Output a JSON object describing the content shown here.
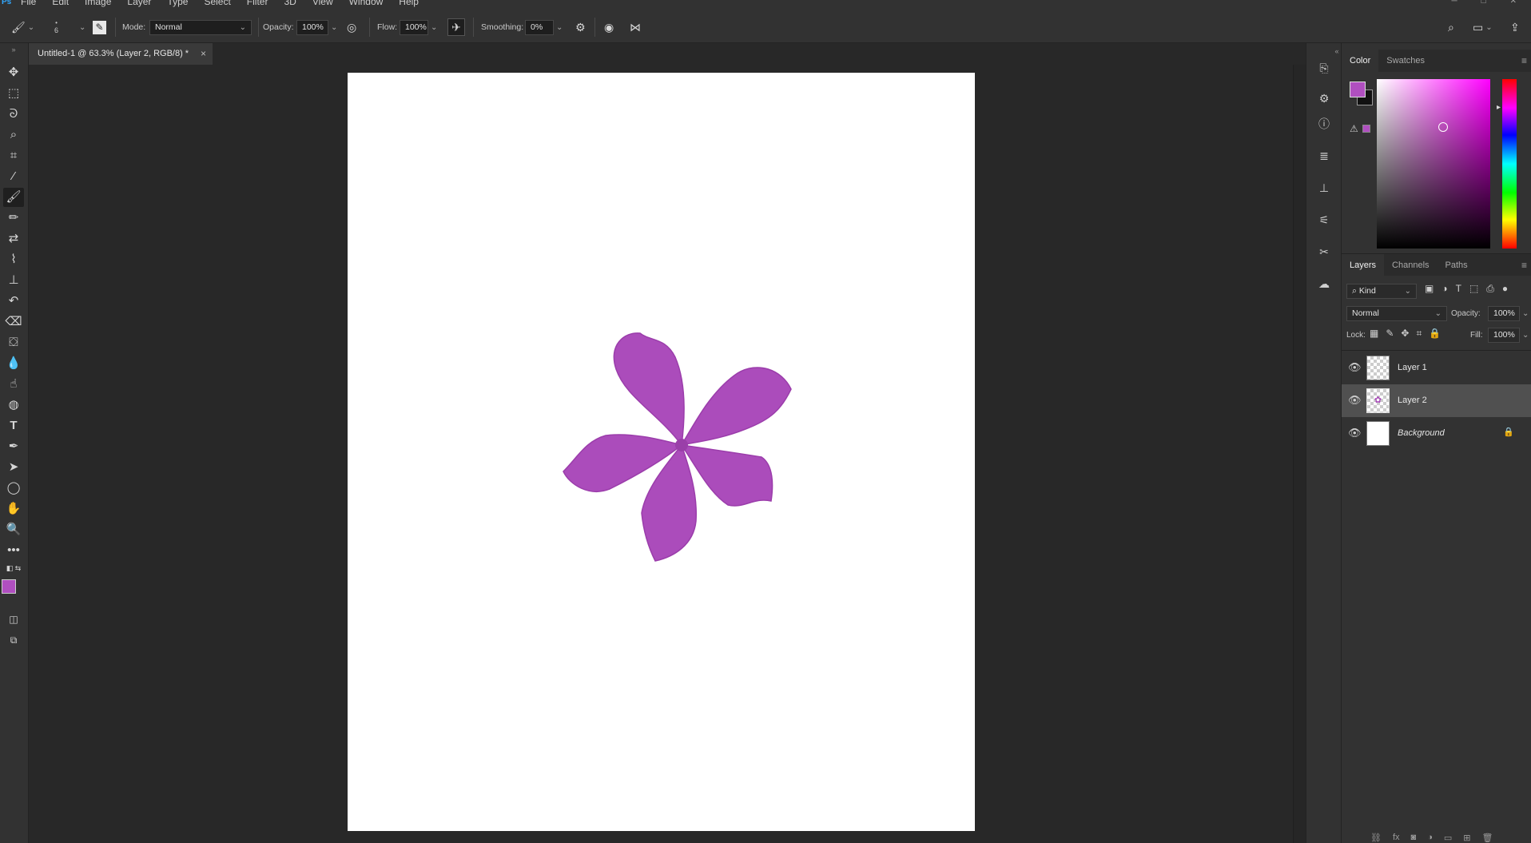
{
  "menubar": {
    "logo": "Ps",
    "items": [
      "File",
      "Edit",
      "Image",
      "Layer",
      "Type",
      "Select",
      "Filter",
      "3D",
      "View",
      "Window",
      "Help"
    ]
  },
  "options": {
    "brush_size": "6",
    "mode_label": "Mode:",
    "mode_value": "Normal",
    "opacity_label": "Opacity:",
    "opacity_value": "100%",
    "flow_label": "Flow:",
    "flow_value": "100%",
    "smoothing_label": "Smoothing:",
    "smoothing_value": "0%"
  },
  "document": {
    "tab_title": "Untitled-1 @ 63.3% (Layer 2, RGB/8) *",
    "tab_close": "×"
  },
  "color_panel": {
    "tabs": [
      "Color",
      "Swatches"
    ],
    "foreground_color": "#b04fc0",
    "background_color": "#111111",
    "picker_hue": "#ff00ff"
  },
  "layers_panel": {
    "tabs": [
      "Layers",
      "Channels",
      "Paths"
    ],
    "filter_label": "Kind",
    "blend_mode": "Normal",
    "opacity_label": "Opacity:",
    "opacity_value": "100%",
    "lock_label": "Lock:",
    "fill_label": "Fill:",
    "fill_value": "100%",
    "layers": [
      {
        "name": "Layer 1",
        "selected": false
      },
      {
        "name": "Layer 2",
        "selected": true
      },
      {
        "name": "Background",
        "selected": false,
        "locked": true
      }
    ]
  },
  "canvas": {
    "flower_color": "#ab4cbb"
  }
}
